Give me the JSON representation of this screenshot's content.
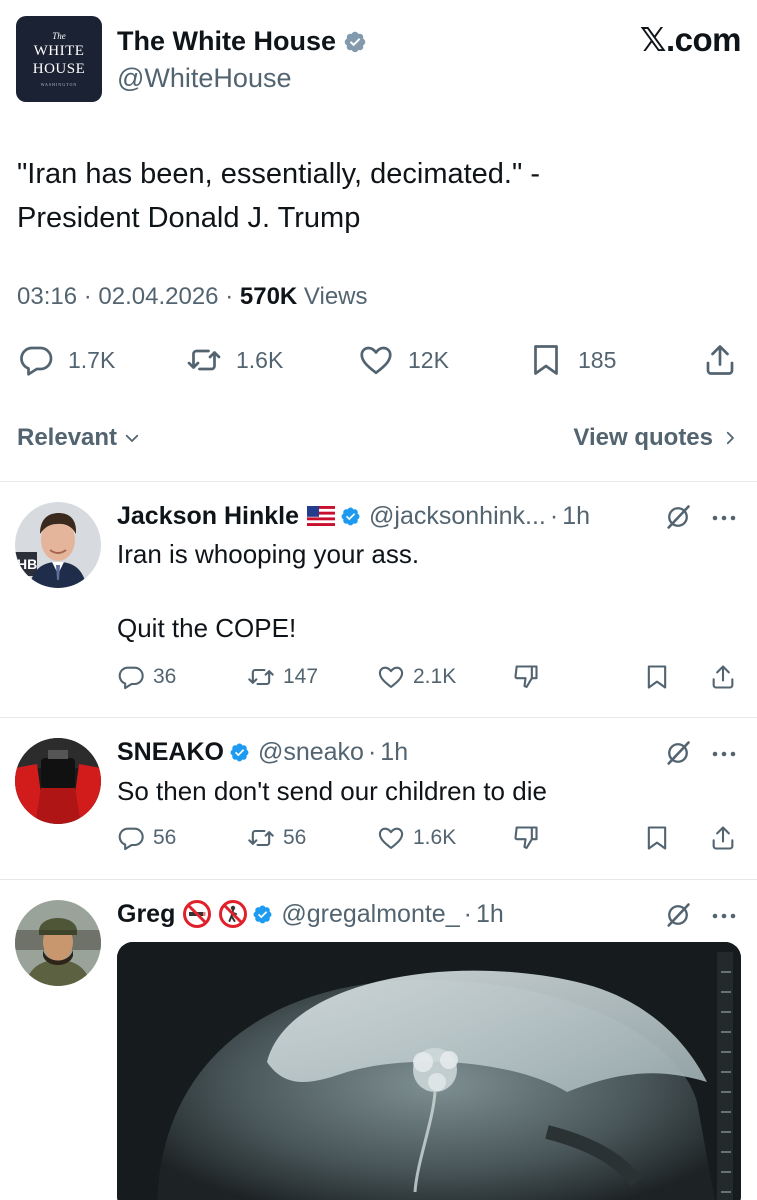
{
  "brand": "𝕏.com",
  "logo": {
    "line1": "The",
    "line2": "WHITE",
    "line3": "HOUSE",
    "line4": "WASHINGTON"
  },
  "tweet": {
    "author_name": "The White House",
    "author_handle": "@WhiteHouse",
    "text": "\"Iran has been, essentially, decimated.\" -\nPresident Donald J. Trump",
    "time": "03:16",
    "date": "02.04.2026",
    "views_count": "570K",
    "views_label": "Views",
    "separator": "·",
    "stats": {
      "replies": "1.7K",
      "reposts": "1.6K",
      "likes": "12K",
      "bookmarks": "185"
    }
  },
  "sort": {
    "label": "Relevant",
    "view_quotes": "View quotes"
  },
  "replies": [
    {
      "name": "Jackson Hinkle",
      "handle": "@jacksonhink...",
      "dot": "·",
      "time": "1h",
      "text": "Iran is whooping your ass.\n\nQuit the COPE!",
      "replies": "36",
      "reposts": "147",
      "likes": "2.1K"
    },
    {
      "name": "SNEAKO",
      "handle": "@sneako",
      "dot": "·",
      "time": "1h",
      "text": "So then don't send our children to die",
      "replies": "56",
      "reposts": "56",
      "likes": "1.6K"
    },
    {
      "name": "Greg",
      "handle": "@gregalmonte_",
      "dot": "·",
      "time": "1h"
    }
  ],
  "colors": {
    "verified": "#1d9bf0",
    "secondary_text": "#536471",
    "primary_text": "#0f1419",
    "divider": "#e6e9ec",
    "logo_bg": "#1b2233"
  },
  "icons": [
    "verified-badge-icon",
    "reply-icon",
    "repost-icon",
    "like-icon",
    "bookmark-icon",
    "share-icon",
    "dislike-icon",
    "grok-icon",
    "more-icon",
    "chevron-down-icon",
    "chevron-right-icon",
    "us-flag-icon",
    "no-smoking-icon",
    "no-pedestrians-icon"
  ]
}
